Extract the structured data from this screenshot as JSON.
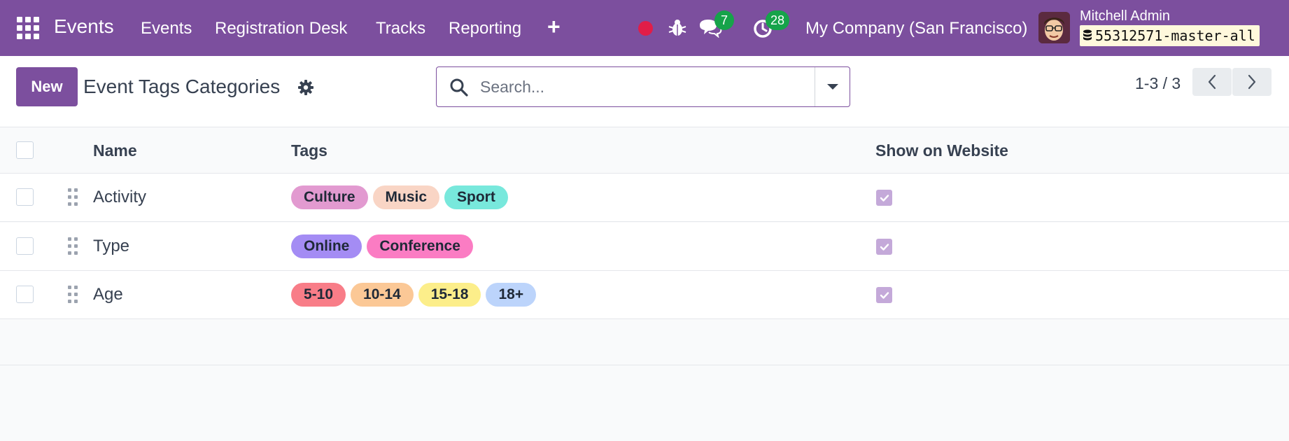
{
  "navbar": {
    "brand": "Events",
    "menu": [
      "Events",
      "Registration Desk",
      "Tracks",
      "Reporting"
    ],
    "messages_count": "7",
    "activities_count": "28",
    "company": "My Company (San Francisco)",
    "user_name": "Mitchell Admin",
    "database": "55312571-master-all",
    "accent_color": "#7c4f9e"
  },
  "control_panel": {
    "new_label": "New",
    "title": "Event Tags Categories",
    "search_placeholder": "Search...",
    "pager": "1-3 / 3"
  },
  "table": {
    "headers": {
      "name": "Name",
      "tags": "Tags",
      "website": "Show on Website"
    },
    "rows": [
      {
        "name": "Activity",
        "tags": [
          {
            "label": "Culture",
            "color": "#e29ad0"
          },
          {
            "label": "Music",
            "color": "#f9d5c5"
          },
          {
            "label": "Sport",
            "color": "#78e8dc"
          }
        ],
        "show_on_website": true
      },
      {
        "name": "Type",
        "tags": [
          {
            "label": "Online",
            "color": "#a48cf4"
          },
          {
            "label": "Conference",
            "color": "#fb7cc3"
          }
        ],
        "show_on_website": true
      },
      {
        "name": "Age",
        "tags": [
          {
            "label": "5-10",
            "color": "#f87d88"
          },
          {
            "label": "10-14",
            "color": "#fbc896"
          },
          {
            "label": "15-18",
            "color": "#fcee8a"
          },
          {
            "label": "18+",
            "color": "#bcd4fb"
          }
        ],
        "show_on_website": true
      }
    ]
  }
}
